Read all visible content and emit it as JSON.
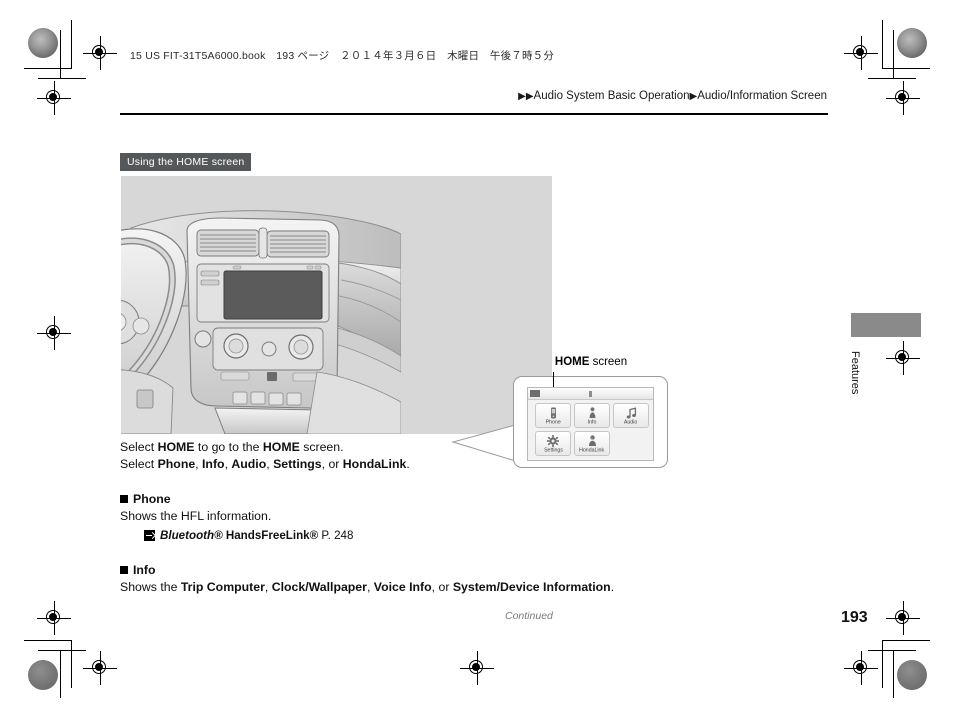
{
  "header": {
    "book_line": "15 US FIT-31T5A6000.book　193 ページ　２０１４年３月６日　木曜日　午後７時５分",
    "breadcrumb_arrows": "▶▶",
    "breadcrumb_1": "Audio System Basic Operation",
    "breadcrumb_sep": "▶",
    "breadcrumb_2": "Audio/Information Screen"
  },
  "section": {
    "badge": "Using the HOME screen"
  },
  "figure": {
    "caption_bold": "HOME",
    "caption_rest": " screen",
    "home_screen": {
      "tiles": [
        {
          "label": "Phone",
          "icon": "phone-handset-icon"
        },
        {
          "label": "Info",
          "icon": "info-person-icon"
        },
        {
          "label": "Audio",
          "icon": "music-note-icon"
        },
        {
          "label": "Settings",
          "icon": "gear-icon"
        },
        {
          "label": "HondaLink",
          "icon": "hondalink-icon"
        }
      ],
      "status_bar_icon": "signal-icon"
    }
  },
  "body": {
    "line1_pre": "Select ",
    "line1_b1": "HOME",
    "line1_mid": " to go to the ",
    "line1_b2": "HOME",
    "line1_end": " screen.",
    "line2_pre": "Select ",
    "line2_b1": "Phone",
    "line2_s1": ", ",
    "line2_b2": "Info",
    "line2_s2": ", ",
    "line2_b3": "Audio",
    "line2_s3": ", ",
    "line2_b4": "Settings",
    "line2_s4": ", or ",
    "line2_b5": "HondaLink",
    "line2_end": ".",
    "phone_heading": "Phone",
    "phone_text": "Shows the HFL information.",
    "phone_xref_bt": "Bluetooth®",
    "phone_xref_hfl": " HandsFreeLink®",
    "phone_xref_page": " P. 248",
    "info_heading": "Info",
    "info_pre": "Shows the ",
    "info_b1": "Trip Computer",
    "info_s1": ", ",
    "info_b2": "Clock/Wallpaper",
    "info_s2": ", ",
    "info_b3": "Voice Info",
    "info_s3": ", or ",
    "info_b4": "System/Device Information",
    "info_end": "."
  },
  "footer": {
    "continued": "Continued",
    "page_number": "193"
  },
  "side_tab": {
    "label": "Features"
  },
  "colors": {
    "badge_bg": "#55585a",
    "figure_bg": "#d7d7d7",
    "tab_gray": "#8a8a8a",
    "continued_gray": "#7a7a7a"
  }
}
